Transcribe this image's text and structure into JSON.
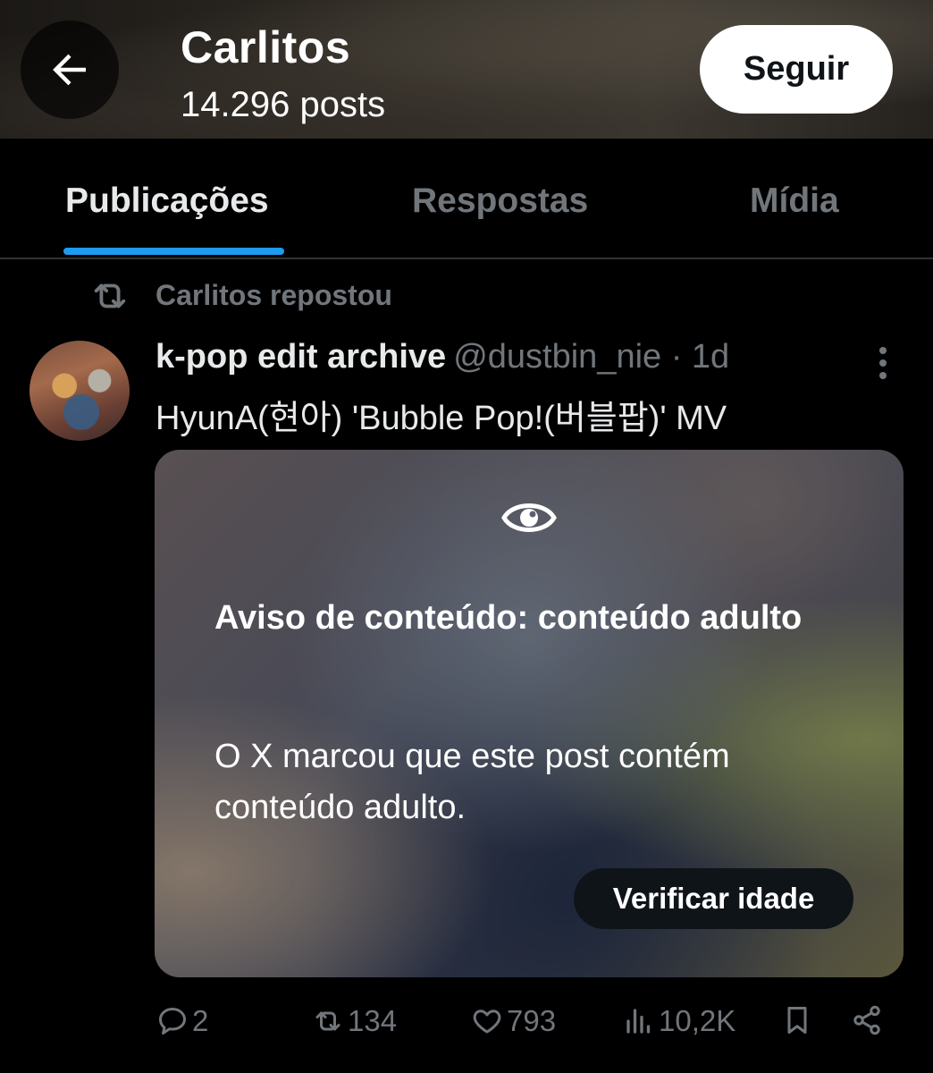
{
  "header": {
    "title": "Carlitos",
    "subtitle": "14.296 posts",
    "follow_label": "Seguir"
  },
  "tabs": [
    {
      "label": "Publicações",
      "active": true
    },
    {
      "label": "Respostas",
      "active": false
    },
    {
      "label": "Mídia",
      "active": false
    }
  ],
  "post": {
    "repost_text": "Carlitos repostou",
    "author_name": "k-pop edit archive",
    "author_meta": "@dustbin_nie · 1d",
    "text": "HyunA(현아) 'Bubble Pop!(버블팝)' MV",
    "warning": {
      "title": "Aviso de conteúdo: conteúdo adulto",
      "body": "O X marcou que este post contém conteúdo adulto.",
      "button_label": "Verificar idade"
    },
    "actions": {
      "replies": "2",
      "reposts": "134",
      "likes": "793",
      "views": "10,2K"
    }
  },
  "colors": {
    "accent": "#1d9bf0",
    "background": "#000000",
    "muted_text": "#71767b"
  }
}
